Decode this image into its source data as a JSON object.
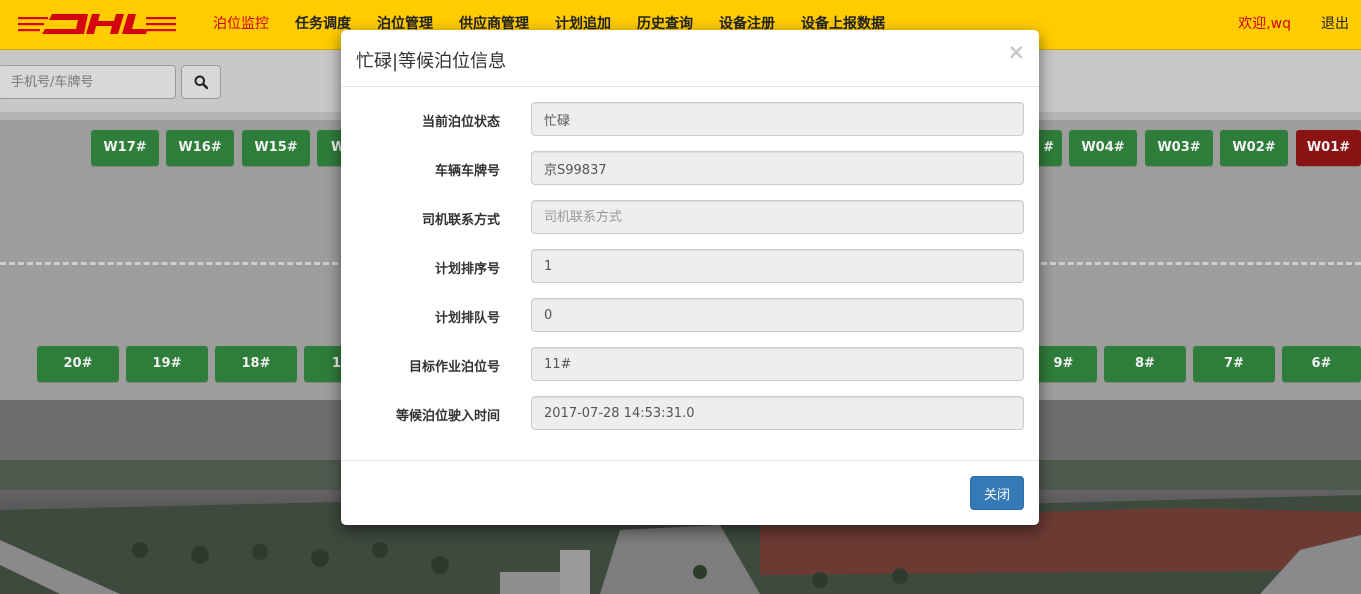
{
  "brand": {
    "logo_text": "DHL",
    "logo_color": "#d40511",
    "navbar_color": "#ffcc00"
  },
  "nav": {
    "items": [
      {
        "label": "泊位监控",
        "active": true
      },
      {
        "label": "任务调度"
      },
      {
        "label": "泊位管理"
      },
      {
        "label": "供应商管理"
      },
      {
        "label": "计划追加"
      },
      {
        "label": "历史查询"
      },
      {
        "label": "设备注册"
      },
      {
        "label": "设备上报数据"
      }
    ],
    "welcome": "欢迎,wq",
    "logout": "退出"
  },
  "search": {
    "placeholder": "手机号/车牌号",
    "button_icon": "search-icon"
  },
  "yard": {
    "top_slots": [
      {
        "label": "W17#",
        "status": "free"
      },
      {
        "label": "W16#",
        "status": "free"
      },
      {
        "label": "W15#",
        "status": "free"
      },
      {
        "label": "W",
        "status": "free"
      },
      {
        "label": "#",
        "status": "free"
      },
      {
        "label": "W04#",
        "status": "free"
      },
      {
        "label": "W03#",
        "status": "free"
      },
      {
        "label": "W02#",
        "status": "free"
      },
      {
        "label": "W01#",
        "status": "busy"
      }
    ],
    "bottom_slots": [
      {
        "label": "20#"
      },
      {
        "label": "19#"
      },
      {
        "label": "18#"
      },
      {
        "label": "1"
      },
      {
        "label": "9#"
      },
      {
        "label": "8#"
      },
      {
        "label": "7#"
      },
      {
        "label": "6#"
      }
    ],
    "free_color": "#5cb85c",
    "busy_color": "#d9534f"
  },
  "modal": {
    "title": "忙碌|等候泊位信息",
    "close_icon": "×",
    "fields": [
      {
        "label": "当前泊位状态",
        "value": "忙碌",
        "placeholder": ""
      },
      {
        "label": "车辆车牌号",
        "value": "京S99837",
        "placeholder": ""
      },
      {
        "label": "司机联系方式",
        "value": "",
        "placeholder": "司机联系方式"
      },
      {
        "label": "计划排序号",
        "value": "1",
        "placeholder": ""
      },
      {
        "label": "计划排队号",
        "value": "0",
        "placeholder": ""
      },
      {
        "label": "目标作业泊位号",
        "value": "11#",
        "placeholder": ""
      },
      {
        "label": "等候泊位驶入时间",
        "value": "2017-07-28 14:53:31.0",
        "placeholder": ""
      }
    ],
    "close_button": "关闭",
    "button_color": "#337ab7"
  }
}
